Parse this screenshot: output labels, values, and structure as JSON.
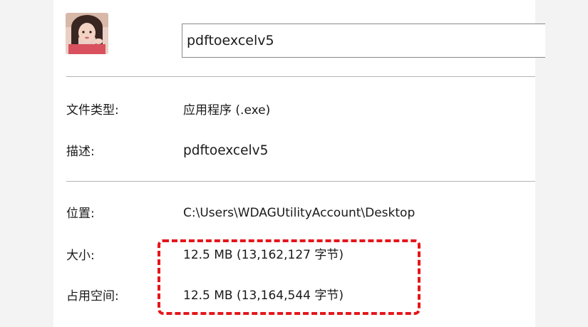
{
  "file": {
    "name": "pdftoexcelv5"
  },
  "properties": {
    "type_label": "文件类型:",
    "type_value": "应用程序 (.exe)",
    "desc_label": "描述:",
    "desc_value": "pdftoexcelv5",
    "location_label": "位置:",
    "location_value": "C:\\Users\\WDAGUtilityAccount\\Desktop",
    "size_label": "大小:",
    "size_value": "12.5 MB (13,162,127 字节)",
    "disk_label": "占用空间:",
    "disk_value": "12.5 MB (13,164,544 字节)"
  },
  "colors": {
    "highlight": "#e4161b",
    "divider": "#b5b5b5"
  },
  "icons": {
    "avatar": "user-photo-avatar"
  }
}
